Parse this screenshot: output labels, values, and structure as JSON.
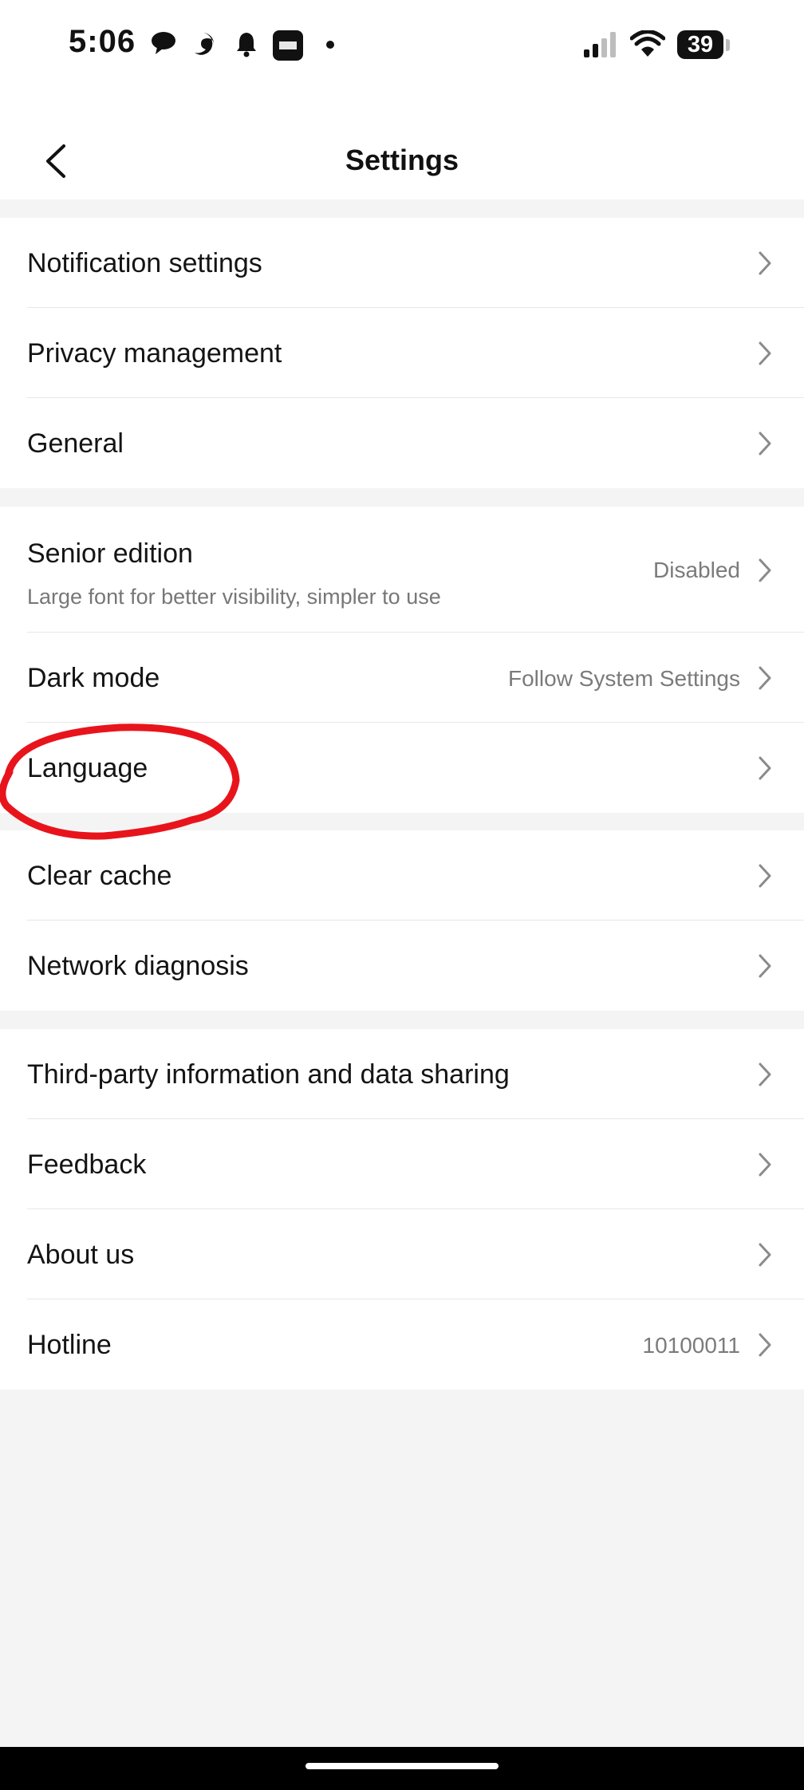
{
  "status_bar": {
    "time": "5:06",
    "battery": "39",
    "icons": [
      "chat-bubble-icon",
      "edge-browser-icon",
      "bell-icon",
      "app-notification-icon",
      "dot-icon",
      "signal-icon",
      "wifi-icon",
      "battery-icon"
    ]
  },
  "header": {
    "title": "Settings",
    "back_icon": "chevron-left-icon"
  },
  "groups": [
    {
      "items": [
        {
          "label": "Notification settings"
        },
        {
          "label": "Privacy management"
        },
        {
          "label": "General"
        }
      ]
    },
    {
      "items": [
        {
          "label": "Senior edition",
          "subtitle": "Large font for better visibility, simpler to use",
          "value": "Disabled"
        },
        {
          "label": "Dark mode",
          "value": "Follow System Settings"
        },
        {
          "label": "Language"
        }
      ]
    },
    {
      "items": [
        {
          "label": "Clear cache"
        },
        {
          "label": "Network diagnosis"
        }
      ]
    },
    {
      "items": [
        {
          "label": "Third-party information and data sharing"
        },
        {
          "label": "Feedback"
        },
        {
          "label": "About us"
        },
        {
          "label": "Hotline",
          "value": "10100011"
        }
      ]
    }
  ],
  "annotation": {
    "shape": "ellipse",
    "color": "#e8141c",
    "target": "Language"
  },
  "colors": {
    "background": "#f4f4f4",
    "row": "#ffffff",
    "divider": "#e6e6e6",
    "secondary_text": "#7b7b7b"
  }
}
